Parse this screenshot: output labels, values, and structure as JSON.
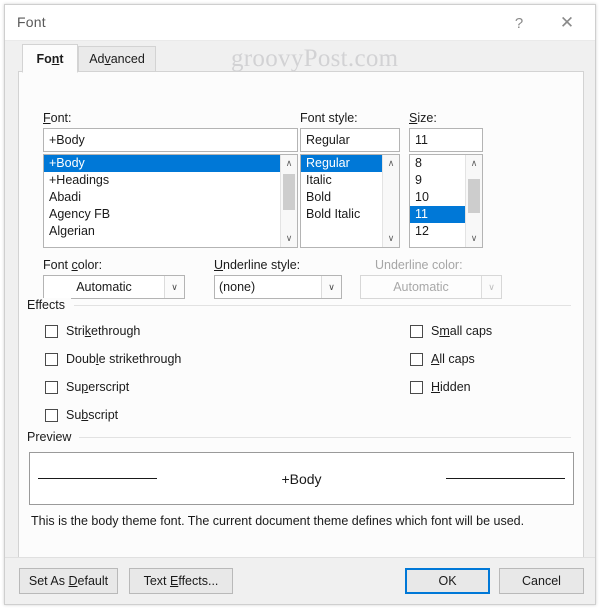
{
  "window": {
    "title": "Font",
    "help_icon": "question-mark-icon",
    "close_icon": "close-x-icon",
    "help_label": "?",
    "close_label": "✕"
  },
  "watermark": "groovyPost.com",
  "accent_color": "#0078d7",
  "tabs": [
    {
      "label": "Font",
      "active": true
    },
    {
      "label": "Advanced",
      "active": false
    }
  ],
  "font_section": {
    "font_label": "Font:",
    "font_value": "+Body",
    "font_options": [
      "+Body",
      "+Headings",
      "Abadi",
      "Agency FB",
      "Algerian"
    ],
    "font_selected": "+Body",
    "style_label": "Font style:",
    "style_value": "Regular",
    "style_options": [
      "Regular",
      "Italic",
      "Bold",
      "Bold Italic"
    ],
    "style_selected": "Regular",
    "size_label": "Size:",
    "size_value": "11",
    "size_options": [
      "8",
      "9",
      "10",
      "11",
      "12"
    ],
    "size_selected": "11"
  },
  "color_section": {
    "font_color_label": "Font color:",
    "font_color_value": "Automatic",
    "underline_style_label": "Underline style:",
    "underline_style_value": "(none)",
    "underline_color_label": "Underline color:",
    "underline_color_value": "Automatic",
    "underline_color_disabled": true
  },
  "effects": {
    "group_label": "Effects",
    "left_column": [
      {
        "label": "Strikethrough",
        "checked": false
      },
      {
        "label": "Double strikethrough",
        "checked": false
      },
      {
        "label": "Superscript",
        "checked": false
      },
      {
        "label": "Subscript",
        "checked": false
      }
    ],
    "right_column": [
      {
        "label": "Small caps",
        "checked": false
      },
      {
        "label": "All caps",
        "checked": false
      },
      {
        "label": "Hidden",
        "checked": false
      }
    ]
  },
  "preview": {
    "group_label": "Preview",
    "sample_text": "+Body",
    "description": "This is the body theme font. The current document theme defines which font will be used."
  },
  "footer": {
    "set_as_default": "Set As Default",
    "text_effects": "Text Effects...",
    "ok": "OK",
    "cancel": "Cancel"
  },
  "scroll_icons": {
    "up": "∧",
    "down": "∨",
    "chevron": "∨"
  }
}
